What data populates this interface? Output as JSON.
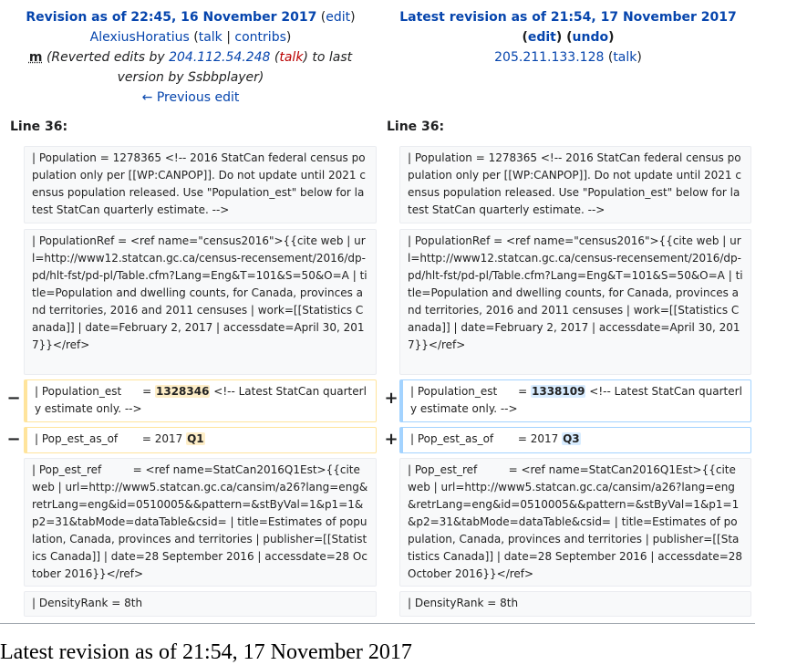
{
  "left": {
    "title": "Revision as of 22:45, 16 November 2017",
    "edit": "edit",
    "user": "AlexiusHoratius",
    "talk": "talk",
    "contribs": "contribs",
    "minor": "m",
    "summary_pre": "(Reverted edits by",
    "summary_ip": "204.112.54.248",
    "summary_talk": "talk",
    "summary_post": ") to last version by Ssbbplayer)",
    "prev": "← Previous edit"
  },
  "right": {
    "title": "Latest revision as of 21:54, 17 November 2017",
    "edit": "edit",
    "undo": "undo",
    "user": "205.211.133.128",
    "talk": "talk"
  },
  "line_label": "Line 36:",
  "rows": {
    "population": "| Population = 1278365 <!-- 2016 StatCan federal census population only per [[WP:CANPOP]]. Do not update until 2021 census population released. Use \"Population_est\" below for latest StatCan quarterly estimate. -->",
    "popref": "| PopulationRef = <ref name=\"census2016\">{{cite web | url=http://www12.statcan.gc.ca/census-recensement/2016/dp-pd/hlt-fst/pd-pl/Table.cfm?Lang=Eng&T=101&S=50&O=A | title=Population and dwelling counts, for Canada, provinces and territories, 2016 and 2011 censuses | work=[[Statistics Canada]] | date=February 2, 2017 | accessdate=April 30, 2017}}</ref>",
    "popest_pre": "| Population_est      = ",
    "popest_left_val": "1328346",
    "popest_right_val": "1338109",
    "popest_post": " <!-- Latest StatCan quarterly estimate only. -->",
    "popasof_pre": "| Pop_est_as_of       = 2017 ",
    "popasof_left_val": "Q1",
    "popasof_right_val": "Q3",
    "popestref": "| Pop_est_ref         = <ref name=StatCan2016Q1Est>{{cite web | url=http://www5.statcan.gc.ca/cansim/a26?lang=eng&retrLang=eng&id=0510005&&pattern=&stByVal=1&p1=1&p2=31&tabMode=dataTable&csid= | title=Estimates of population, Canada, provinces and territories | publisher=[[Statistics Canada]] | date=28 September 2016 | accessdate=28 October 2016}}</ref>",
    "density": "| DensityRank = 8th"
  },
  "markers": {
    "minus": "−",
    "plus": "+"
  },
  "bottom_title": "Latest revision as of 21:54, 17 November 2017"
}
